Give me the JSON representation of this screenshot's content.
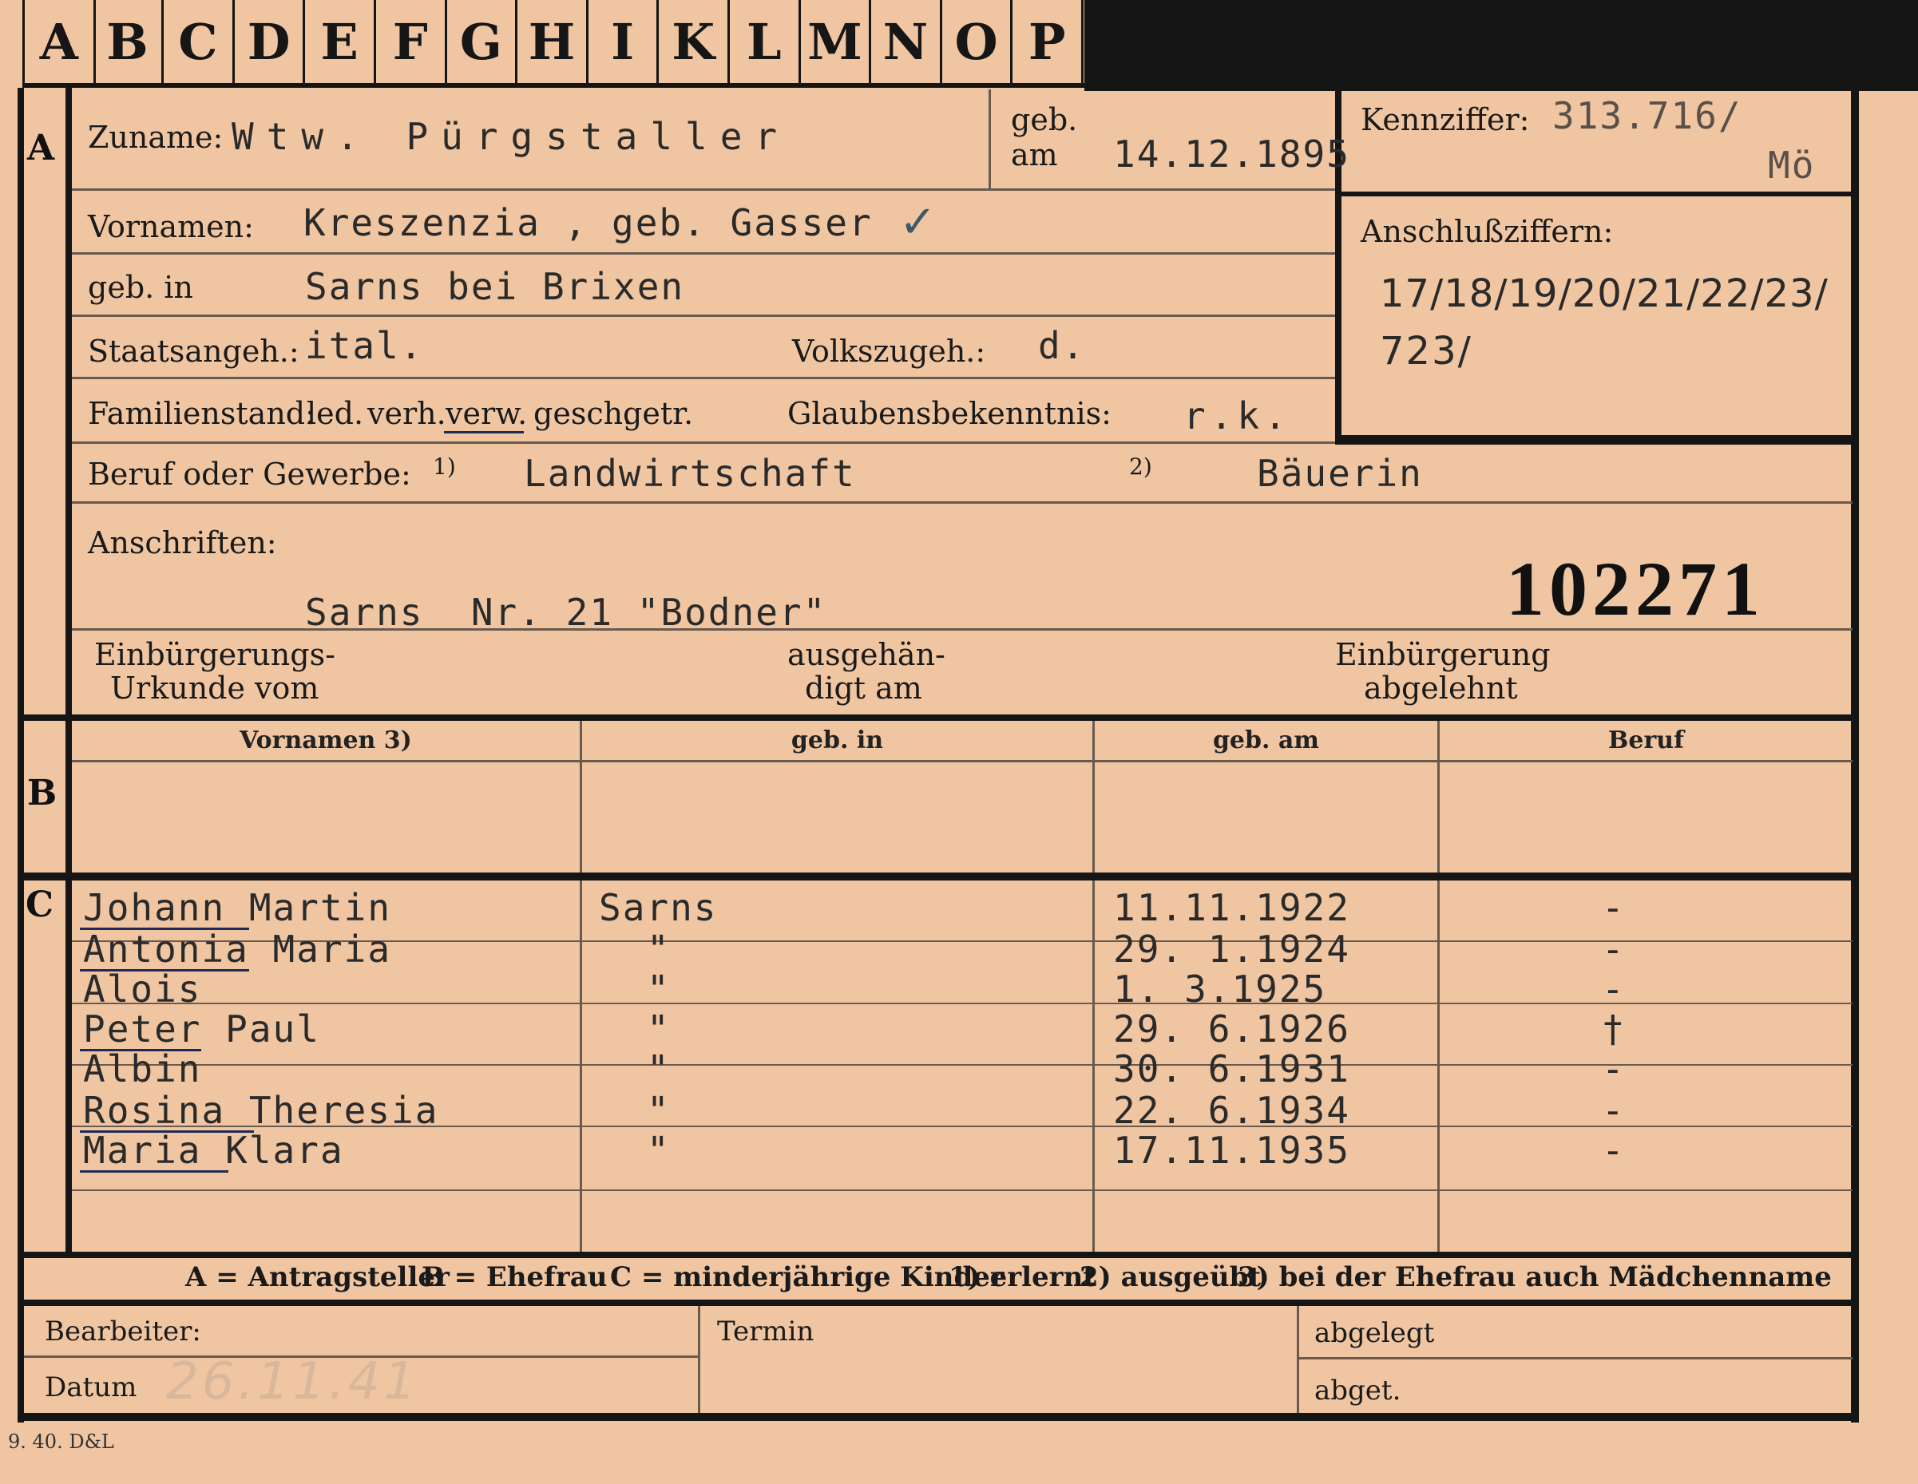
{
  "tabs": [
    "A",
    "B",
    "C",
    "D",
    "E",
    "F",
    "G",
    "H",
    "I",
    "K",
    "L",
    "M",
    "N",
    "O",
    "P"
  ],
  "section_a": {
    "marker": "A",
    "zuname_label": "Zuname:",
    "zuname_value": "Wtw. Pürgstaller",
    "geb_am_label_1": "geb.",
    "geb_am_label_2": "am",
    "geb_am_value": "14.12.1895",
    "kennziffer_label": "Kennziffer:",
    "kennziffer_value": "313.716/",
    "kennziffer_suffix": "Mö",
    "anschluss_label": "Anschlußziffern:",
    "anschluss_line1": "17/18/19/20/21/22/23/",
    "anschluss_line2": "723/",
    "vornamen_label": "Vornamen:",
    "vornamen_value": "Kreszenzia , geb. Gasser",
    "geb_in_label": "geb. in",
    "geb_in_value": "Sarns bei Brixen",
    "staatsangeh_label": "Staatsangeh.:",
    "staatsangeh_value": "ital.",
    "volkszugeh_label": "Volkszugeh.:",
    "volkszugeh_value": "d.",
    "familienstand_label": "Familienstand:",
    "familienstand_options": [
      "led.",
      "verh.",
      "verw.",
      "gesch.",
      "getr."
    ],
    "familienstand_selected": "verw.",
    "glaubens_label": "Glaubensbekenntnis:",
    "glaubens_value": "r.k.",
    "beruf_label": "Beruf oder Gewerbe:",
    "beruf_fn1": "1)",
    "beruf_value1": "Landwirtschaft",
    "beruf_fn2": "2)",
    "beruf_value2": "Bäuerin",
    "anschriften_label": "Anschriften:",
    "anschriften_value": "Sarns  Nr. 21 \"Bodner\"",
    "stamp_number": "102271",
    "urkunde_label_1": "Einbürgerungs-",
    "urkunde_label_2": "Urkunde vom",
    "ausgeh_label_1": "ausgehän-",
    "ausgeh_label_2": "digt am",
    "abgelehnt_label_1": "Einbürgerung",
    "abgelehnt_label_2": "abgelehnt"
  },
  "section_b": {
    "marker": "B",
    "columns": [
      "Vornamen 3)",
      "geb. in",
      "geb. am",
      "Beruf"
    ]
  },
  "section_c": {
    "marker": "C",
    "rows": [
      {
        "name": "Johann Martin",
        "place": "Sarns",
        "date": "11.11.1922",
        "beruf": "-"
      },
      {
        "name": "Antonia Maria",
        "place": "\"",
        "date": "29. 1.1924",
        "beruf": "-"
      },
      {
        "name": "Alois",
        "place": "\"",
        "date": "1. 3.1925",
        "beruf": "-"
      },
      {
        "name": "Peter Paul",
        "place": "\"",
        "date": "29. 6.1926",
        "beruf": "†"
      },
      {
        "name": "Albin",
        "place": "\"",
        "date": "30. 6.1931",
        "beruf": "-"
      },
      {
        "name": "Rosina Theresia",
        "place": "\"",
        "date": "22. 6.1934",
        "beruf": "-"
      },
      {
        "name": "Maria Klara",
        "place": "\"",
        "date": "17.11.1935",
        "beruf": "-"
      }
    ]
  },
  "legend": {
    "a": "A = Antragsteller",
    "b": "B = Ehefrau",
    "c": "C = minderjährige Kinder",
    "fn1": "1) erlernt",
    "fn2": "2) ausgeübt",
    "fn3": "3) bei der Ehefrau auch Mädchenname"
  },
  "footer": {
    "bearbeiter_label": "Bearbeiter:",
    "datum_label": "Datum",
    "datum_value": "26.11.41",
    "termin_label": "Termin",
    "abgelegt_label": "abgelegt",
    "abget_label": "abget."
  },
  "print_code": "9. 40. D&L"
}
